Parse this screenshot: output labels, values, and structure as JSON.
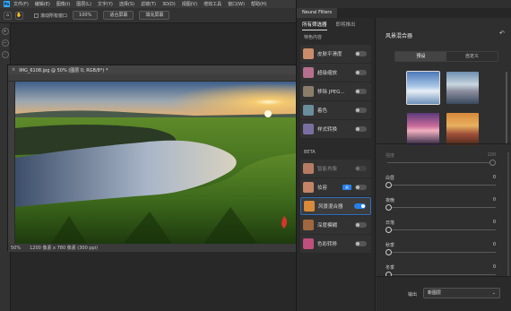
{
  "app": {
    "logo": "Ps"
  },
  "menu": [
    "文件(F)",
    "编辑(E)",
    "图像(I)",
    "图层(L)",
    "文字(Y)",
    "选择(S)",
    "滤镜(T)",
    "3D(D)",
    "视图(V)",
    "增效工具",
    "窗口(W)",
    "帮助(H)"
  ],
  "options": {
    "scroll_all": "滚动所有窗口",
    "zoom": "100%",
    "fit_screen": "适合屏幕",
    "fill_screen": "填充屏幕"
  },
  "document": {
    "tab_title": "IMG_6108.jpg @ 50% (图层 0, RGB/8*) *",
    "close_glyph": "×",
    "zoom": "50%",
    "size": "1200 像素 x 780 像素 (300 ppi)"
  },
  "panel": {
    "tab": "Neural Filters",
    "list_tabs": [
      "所有筛选器",
      "即将推出"
    ],
    "featured_header": "特色内容",
    "featured": [
      {
        "label": "皮肤平滑度",
        "enabled": false,
        "icon_color": "#c98d6a"
      },
      {
        "label": "超级缩放",
        "enabled": false,
        "icon_color": "#b66f8e"
      },
      {
        "label": "移除 JPEG...",
        "enabled": false,
        "icon_color": "#8c7d6a"
      },
      {
        "label": "着色",
        "enabled": false,
        "icon_color": "#6a8d9c"
      },
      {
        "label": "样式转换",
        "enabled": false,
        "icon_color": "#7a6fa0"
      }
    ],
    "beta_header": "BETA",
    "beta": [
      {
        "label": "智能肖像",
        "enabled": false,
        "icon_color": "#b77b63",
        "dim": true
      },
      {
        "label": "妆容",
        "enabled": false,
        "icon_color": "#c48466",
        "badge": "云"
      },
      {
        "label": "风景混合器",
        "enabled": true,
        "icon_color": "#d98a3a",
        "selected": true
      },
      {
        "label": "深度模糊",
        "enabled": false,
        "icon_color": "#a0683e"
      },
      {
        "label": "色彩转移",
        "enabled": false,
        "icon_color": "#bf4f7c"
      }
    ],
    "detail": {
      "title": "风景混合器",
      "reset_icon": "↶",
      "tabs": [
        "预设",
        "自定义"
      ],
      "active_tab": "预设",
      "sliders": [
        {
          "label": "强度",
          "value": "100",
          "level": 1.0,
          "dim": true
        },
        {
          "label": "白昼",
          "value": "0",
          "level": 0.0
        },
        {
          "label": "夜晚",
          "value": "0",
          "level": 0.0
        },
        {
          "label": "日落",
          "value": "0",
          "level": 0.0
        },
        {
          "label": "秋季",
          "value": "0",
          "level": 0.0
        },
        {
          "label": "冬季",
          "value": "0",
          "level": 0.0
        }
      ],
      "output_label": "输出",
      "output_value": "新图层"
    }
  }
}
